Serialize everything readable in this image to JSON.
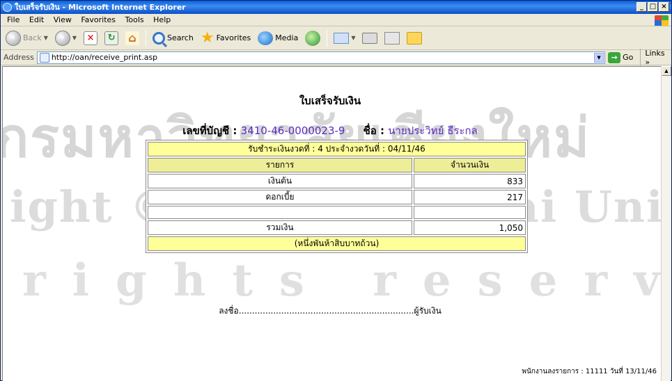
{
  "window": {
    "title": "ใบเสร็จรับเงิน - Microsoft Internet Explorer",
    "controls": {
      "minimize": "_",
      "maximize": "□",
      "close": "×"
    }
  },
  "menu": [
    "File",
    "Edit",
    "View",
    "Favorites",
    "Tools",
    "Help"
  ],
  "toolbar": {
    "back": "Back",
    "search": "Search",
    "favorites": "Favorites",
    "media": "Media"
  },
  "address": {
    "label": "Address",
    "url": "http://oan/receive_print.asp",
    "go": "Go",
    "links": "Links »"
  },
  "watermark": {
    "line1": "กรมหาวิทยาลัยเชียงใหม่",
    "line2": "ight © by Chiang Mai Univers",
    "line3": "rights reserve"
  },
  "document": {
    "title": "ใบเสร็จรับเงิน",
    "account_label": "เลขที่บัญชี : ",
    "account_number": "3410-46-0000023-9",
    "name_label": "ชื่อ : ",
    "name": "นายประวิทย์ ธีระกล",
    "installment_text": "รับชำระเงินงวดที่ : 4    ประจำงวดวันที่ : 04/11/46",
    "col_item": "รายการ",
    "col_amount": "จำนวนเงิน",
    "rows": [
      {
        "item": "เงินต้น",
        "amount": "833"
      },
      {
        "item": "ดอกเบี้ย",
        "amount": "217"
      },
      {
        "item": "",
        "amount": ""
      },
      {
        "item": "รวมเงิน",
        "amount": "1,050"
      }
    ],
    "amount_in_words": "(หนึ่งพันห้าสิบบาทถ้วน)",
    "signature_label": "ลงชื่อ",
    "signature_dots": "..................................................................",
    "signature_role": "ผู้รับเงิน",
    "footer": "พนักงานลงรายการ : 11111   วันที่ 13/11/46"
  }
}
